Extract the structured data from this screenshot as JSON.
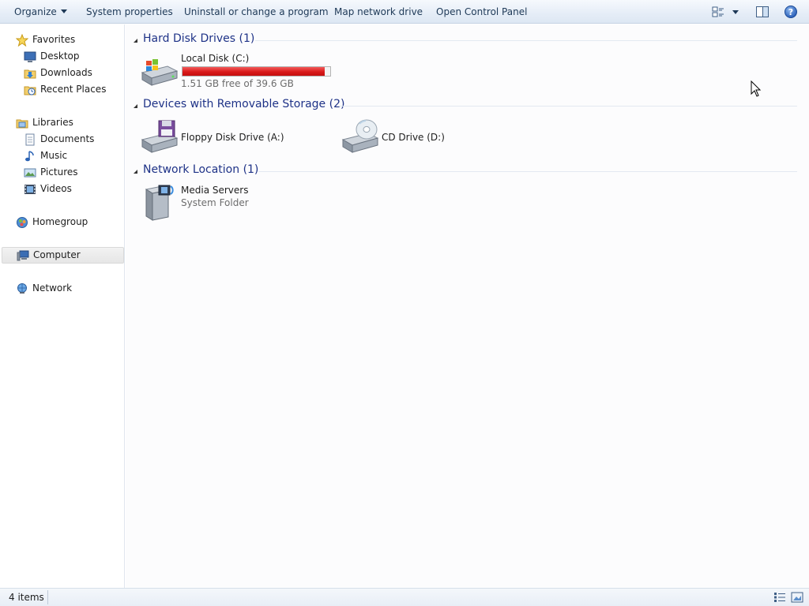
{
  "toolbar": {
    "organize_label": "Organize",
    "system_properties_label": "System properties",
    "uninstall_label": "Uninstall or change a program",
    "map_network_drive_label": "Map network drive",
    "open_control_panel_label": "Open Control Panel",
    "right_icons": [
      "change-view-icon",
      "preview-pane-icon",
      "help-icon"
    ]
  },
  "nav": {
    "favorites": {
      "label": "Favorites",
      "items": [
        {
          "label": "Desktop",
          "icon": "desktop-icon"
        },
        {
          "label": "Downloads",
          "icon": "downloads-folder-icon"
        },
        {
          "label": "Recent Places",
          "icon": "recent-places-icon"
        }
      ]
    },
    "libraries": {
      "label": "Libraries",
      "items": [
        {
          "label": "Documents",
          "icon": "documents-icon"
        },
        {
          "label": "Music",
          "icon": "music-icon"
        },
        {
          "label": "Pictures",
          "icon": "pictures-icon"
        },
        {
          "label": "Videos",
          "icon": "videos-icon"
        }
      ]
    },
    "homegroup": {
      "label": "Homegroup"
    },
    "computer": {
      "label": "Computer",
      "selected": true
    },
    "network": {
      "label": "Network"
    }
  },
  "groups": {
    "hard_disks": {
      "title": "Hard Disk Drives (1)",
      "items": [
        {
          "name": "Local Disk (C:)",
          "detail": "1.51 GB free of 39.6 GB",
          "used_fraction": 0.962,
          "bar_color": "#d91a1a"
        }
      ]
    },
    "removable": {
      "title": "Devices with Removable Storage (2)",
      "items": [
        {
          "name": "Floppy Disk Drive (A:)"
        },
        {
          "name": "CD Drive (D:)"
        }
      ]
    },
    "network_location": {
      "title": "Network Location (1)",
      "items": [
        {
          "name": "Media Servers",
          "detail": "System Folder"
        }
      ]
    }
  },
  "status": {
    "item_count": "4 items"
  },
  "colors": {
    "group_title": "#1e3287",
    "toolbar_text": "#1e3957",
    "usage_bar": "#d91a1a"
  }
}
